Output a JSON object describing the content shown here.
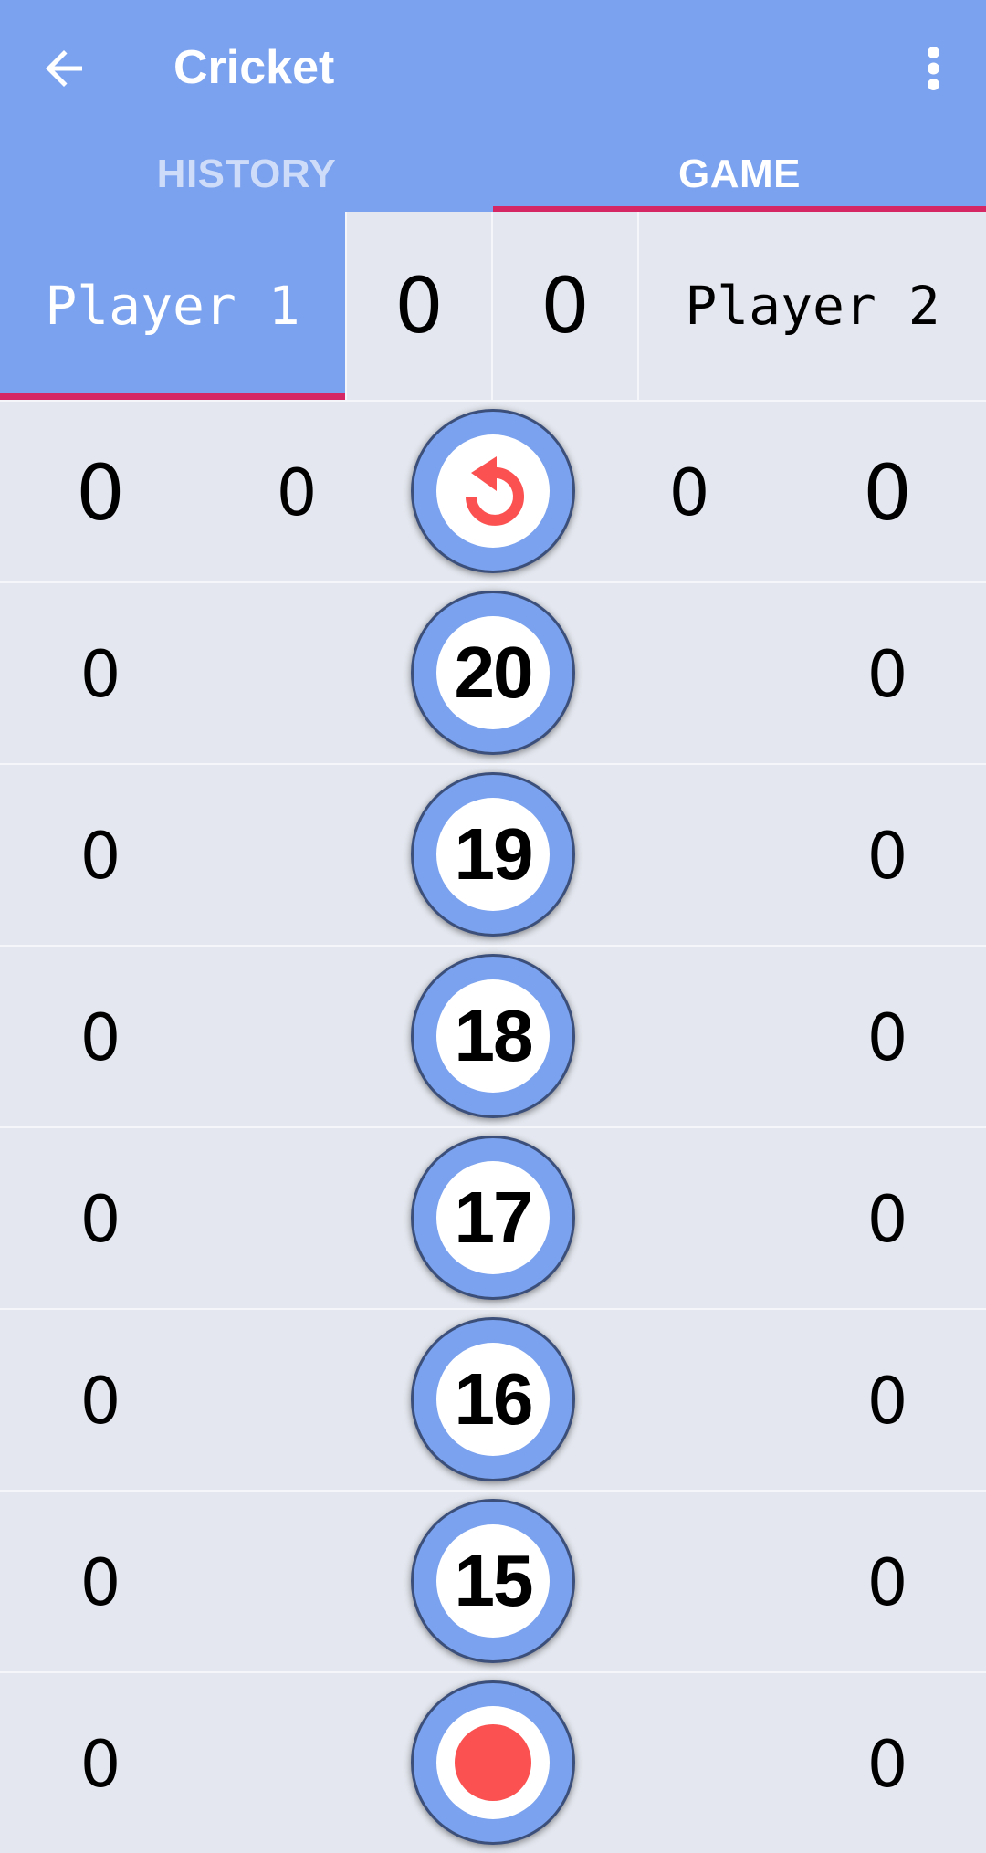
{
  "appbar": {
    "title": "Cricket",
    "back_icon": "arrow-left-icon",
    "menu_icon": "more-vert-icon",
    "background": "#7ba2ee"
  },
  "tabs": [
    {
      "label": "HISTORY",
      "active": false
    },
    {
      "label": "GAME",
      "active": true
    }
  ],
  "accent": "#d52764",
  "players": {
    "player1": {
      "name": "Player 1",
      "score": "0",
      "active": true
    },
    "player2": {
      "name": "Player 2",
      "score": "0",
      "active": false
    }
  },
  "undo_row": {
    "icon": "undo-icon",
    "player1_total": "0",
    "player1_points": "0",
    "player2_points": "0",
    "player2_total": "0"
  },
  "targets": [
    {
      "label": "20",
      "player1": "0",
      "player2": "0"
    },
    {
      "label": "19",
      "player1": "0",
      "player2": "0"
    },
    {
      "label": "18",
      "player1": "0",
      "player2": "0"
    },
    {
      "label": "17",
      "player1": "0",
      "player2": "0"
    },
    {
      "label": "16",
      "player1": "0",
      "player2": "0"
    },
    {
      "label": "15",
      "player1": "0",
      "player2": "0"
    },
    {
      "label": "bull",
      "icon": "bullseye-icon",
      "player1": "0",
      "player2": "0"
    }
  ]
}
